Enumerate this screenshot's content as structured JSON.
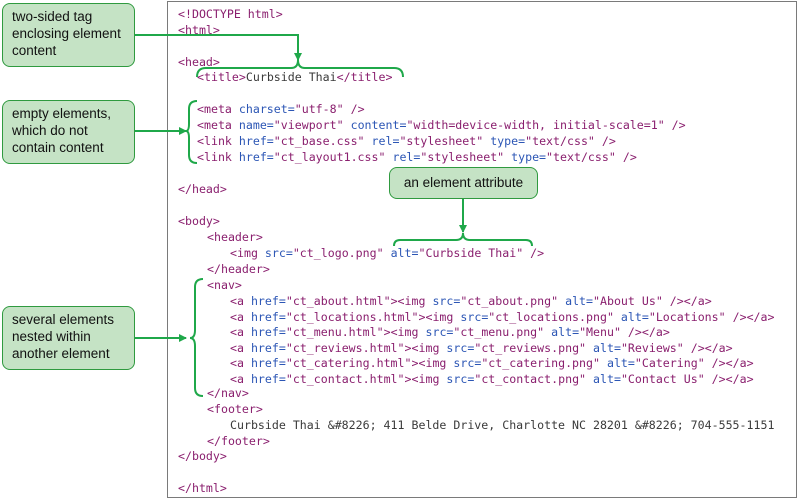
{
  "callouts": {
    "two_sided": [
      "two-sided tag",
      "enclosing element",
      "content"
    ],
    "empty_elements": [
      "empty elements,",
      "which do not",
      "contain content"
    ],
    "attribute": "an element attribute",
    "nested": [
      "several elements",
      "nested within",
      "another element"
    ]
  },
  "code": {
    "doctype": "<!DOCTYPE html>",
    "html_open": "<html>",
    "head_open": "<head>",
    "title": {
      "open": "<title>",
      "text": "Curbside Thai",
      "close": "</title>"
    },
    "meta_charset": {
      "tag": "<meta",
      "attr": "charset=",
      "val": "\"utf-8\"",
      "end": " />"
    },
    "meta_viewport": {
      "tag": "<meta",
      "attr1": "name=",
      "val1": "\"viewport\"",
      "attr2": "content=",
      "val2": "\"width=device-width, initial-scale=1\"",
      "end": " />"
    },
    "link_base": {
      "tag": "<link",
      "attr1": "href=",
      "val1": "\"ct_base.css\"",
      "attr2": "rel=",
      "val2": "\"stylesheet\"",
      "attr3": "type=",
      "val3": "\"text/css\"",
      "end": " />"
    },
    "link_layout": {
      "tag": "<link",
      "attr1": "href=",
      "val1": "\"ct_layout1.css\"",
      "attr2": "rel=",
      "val2": "\"stylesheet\"",
      "attr3": "type=",
      "val3": "\"text/css\"",
      "end": " />"
    },
    "head_close": "</head>",
    "body_open": "<body>",
    "header_open": "<header>",
    "img_logo": {
      "tag": "<img",
      "attr1": "src=",
      "val1": "\"ct_logo.png\"",
      "attr2": "alt=",
      "val2": "\"Curbside Thai\"",
      "end": " />"
    },
    "header_close": "</header>",
    "nav_open": "<nav>",
    "nav_links": [
      {
        "a_open": "<a",
        "href_attr": "href=",
        "href": "\"ct_about.html\"",
        "gt": ">",
        "img": "<img",
        "src_attr": "src=",
        "src": "\"ct_about.png\"",
        "alt_attr": "alt=",
        "alt": "\"About Us\"",
        "end": " />",
        "a_close": "</a>"
      },
      {
        "a_open": "<a",
        "href_attr": "href=",
        "href": "\"ct_locations.html\"",
        "gt": ">",
        "img": "<img",
        "src_attr": "src=",
        "src": "\"ct_locations.png\"",
        "alt_attr": "alt=",
        "alt": "\"Locations\"",
        "end": " />",
        "a_close": "</a>"
      },
      {
        "a_open": "<a",
        "href_attr": "href=",
        "href": "\"ct_menu.html\"",
        "gt": ">",
        "img": "<img",
        "src_attr": "src=",
        "src": "\"ct_menu.png\"",
        "alt_attr": "alt=",
        "alt": "\"Menu\"",
        "end": " />",
        "a_close": "</a>"
      },
      {
        "a_open": "<a",
        "href_attr": "href=",
        "href": "\"ct_reviews.html\"",
        "gt": ">",
        "img": "<img",
        "src_attr": "src=",
        "src": "\"ct_reviews.png\"",
        "alt_attr": "alt=",
        "alt": "\"Reviews\"",
        "end": " />",
        "a_close": "</a>"
      },
      {
        "a_open": "<a",
        "href_attr": "href=",
        "href": "\"ct_catering.html\"",
        "gt": ">",
        "img": "<img",
        "src_attr": "src=",
        "src": "\"ct_catering.png\"",
        "alt_attr": "alt=",
        "alt": "\"Catering\"",
        "end": " />",
        "a_close": "</a>"
      },
      {
        "a_open": "<a",
        "href_attr": "href=",
        "href": "\"ct_contact.html\"",
        "gt": ">",
        "img": "<img",
        "src_attr": "src=",
        "src": "\"ct_contact.png\"",
        "alt_attr": "alt=",
        "alt": "\"Contact Us\"",
        "end": " />",
        "a_close": "</a>"
      }
    ],
    "nav_close": "</nav>",
    "footer_open": "<footer>",
    "footer_text": "Curbside Thai &#8226; 411 Belde Drive, Charlotte NC 28201 &#8226; 704-555-1151",
    "footer_close": "</footer>",
    "body_close": "</body>",
    "html_close": "</html>"
  },
  "colors": {
    "tag": "#8a1f6e",
    "attribute": "#2c56b5",
    "callout_fill": "#c5e3c5",
    "callout_border": "#2f9a3f",
    "connector": "#1fa84a"
  }
}
